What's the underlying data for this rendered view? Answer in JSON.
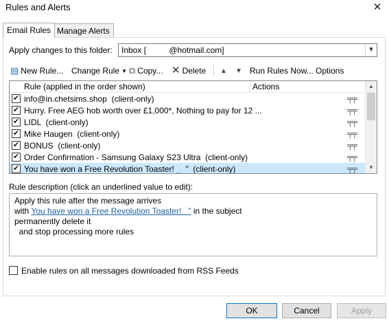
{
  "window": {
    "title": "Rules and Alerts",
    "close": "✕"
  },
  "tabs": [
    {
      "label": "Email Rules"
    },
    {
      "label": "Manage Alerts"
    }
  ],
  "folder": {
    "label": "Apply changes to this folder:",
    "value": "Inbox [          @hotmail.com]"
  },
  "toolbar": {
    "new_rule": "New Rule...",
    "change_rule": "Change Rule",
    "copy": "Copy...",
    "delete": "Delete",
    "run_rules": "Run Rules Now...",
    "options": "Options"
  },
  "rules_list": {
    "col_rule": "Rule (applied in the order shown)",
    "col_actions": "Actions",
    "rows": [
      {
        "text": "info@in.chetsims.shop  (client-only)",
        "checked": true
      },
      {
        "text": "Hurry. Free AEG hob worth over £1,000*, Nothing to pay for 12 ...",
        "checked": true
      },
      {
        "text": "LIDL  (client-only)",
        "checked": true
      },
      {
        "text": "Mike Haugen  (client-only)",
        "checked": true
      },
      {
        "text": "BONUS  (client-only)",
        "checked": true
      },
      {
        "text": "Order Confirmation - Samsung Galaxy S23 Ultra  (client-only)",
        "checked": true
      },
      {
        "text": "You have won a Free Revolution Toaster! _  \"  (client-only)",
        "checked": true
      }
    ]
  },
  "description": {
    "label": "Rule description (click an underlined value to edit):",
    "line1": "Apply this rule after the message arrives",
    "line2_prefix": "with ",
    "line2_link": "You have won a Free Revolution Toaster!   \"",
    "line2_suffix": " in the subject",
    "line3": "permanently delete it",
    "line4": "  and stop processing more rules"
  },
  "rss": {
    "label": "Enable rules on all messages downloaded from RSS Feeds"
  },
  "buttons": {
    "ok": "OK",
    "cancel": "Cancel",
    "apply": "Apply"
  }
}
